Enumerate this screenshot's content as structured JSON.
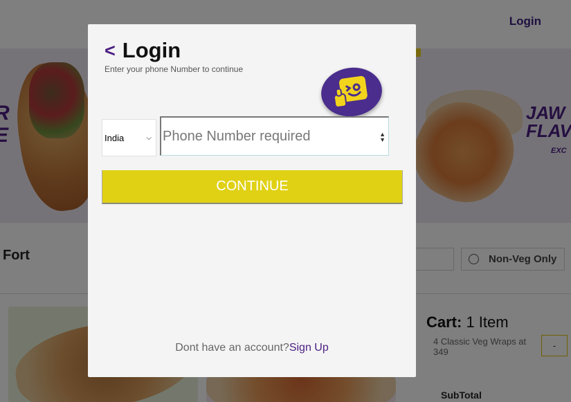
{
  "header": {
    "login_label": "Login"
  },
  "location": {
    "name": "Fort"
  },
  "filters": {
    "non_veg_label": "Non-Veg Only"
  },
  "banner": {
    "left_text": "R\nE",
    "right_text": "JAW\nFLAV",
    "right_sub": "EXC"
  },
  "cart": {
    "title_bold": "Cart:",
    "title_count": " 1 Item",
    "item_line": "4 Classic Veg Wraps at 349",
    "qty_button": "-",
    "subtotal_label": "SubTotal"
  },
  "modal": {
    "back_icon": "<",
    "title": "Login",
    "subtitle": "Enter your phone Number to continue",
    "country_value": "India",
    "phone_placeholder": "Phone Number required",
    "continue_label": "CONTINUE",
    "no_account_text": "Dont have an account?",
    "signup_label": "Sign Up"
  },
  "colors": {
    "brand_purple": "#4a1e82",
    "accent_yellow": "#e0d115"
  }
}
